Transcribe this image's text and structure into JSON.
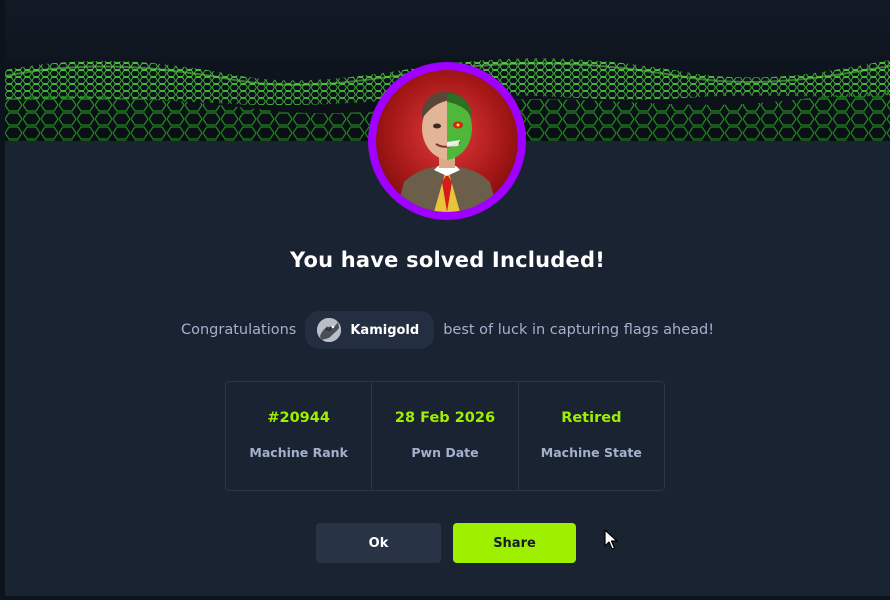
{
  "dialog": {
    "title": "You have solved Included!",
    "congrats_prefix": "Congratulations",
    "username": "Kamigold",
    "congrats_suffix": "best of luck in capturing flags ahead!"
  },
  "stats": [
    {
      "value": "#20944",
      "label": "Machine Rank"
    },
    {
      "value": "28 Feb 2026",
      "label": "Pwn Date"
    },
    {
      "value": "Retired",
      "label": "Machine State"
    }
  ],
  "buttons": {
    "ok": "Ok",
    "share": "Share"
  },
  "colors": {
    "accent_green": "#9fef00",
    "avatar_ring": "#9f00ff",
    "panel_bg": "#1a2332",
    "muted_text": "#a4b1cd"
  },
  "icons": {
    "machine_avatar": "two-face-avatar-icon",
    "user_avatar": "user-avatar-icon",
    "cursor": "mouse-pointer-icon"
  }
}
